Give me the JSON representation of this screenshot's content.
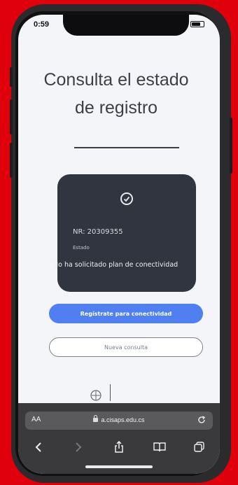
{
  "status_bar": {
    "time": "0:59"
  },
  "page": {
    "title_line1": "Consulta el estado",
    "title_line2": "de registro"
  },
  "card": {
    "icon": "check-circle-icon",
    "rut": "NR: 20309355",
    "state": "Estado",
    "message": "No ha solicitado plan de conectividad"
  },
  "buttons": {
    "primary_label": "Regístrate para conectividad",
    "secondary_label": "Nueva consulta"
  },
  "browser": {
    "reader_label": "AA",
    "url": "a.cisaps.edu.cs",
    "icons": [
      "back-icon",
      "forward-icon",
      "share-icon",
      "bookmarks-icon",
      "tabs-icon"
    ]
  },
  "colors": {
    "primary": "#4f7ff0",
    "card_bg": "#31353f",
    "frame": "#e0000c"
  }
}
